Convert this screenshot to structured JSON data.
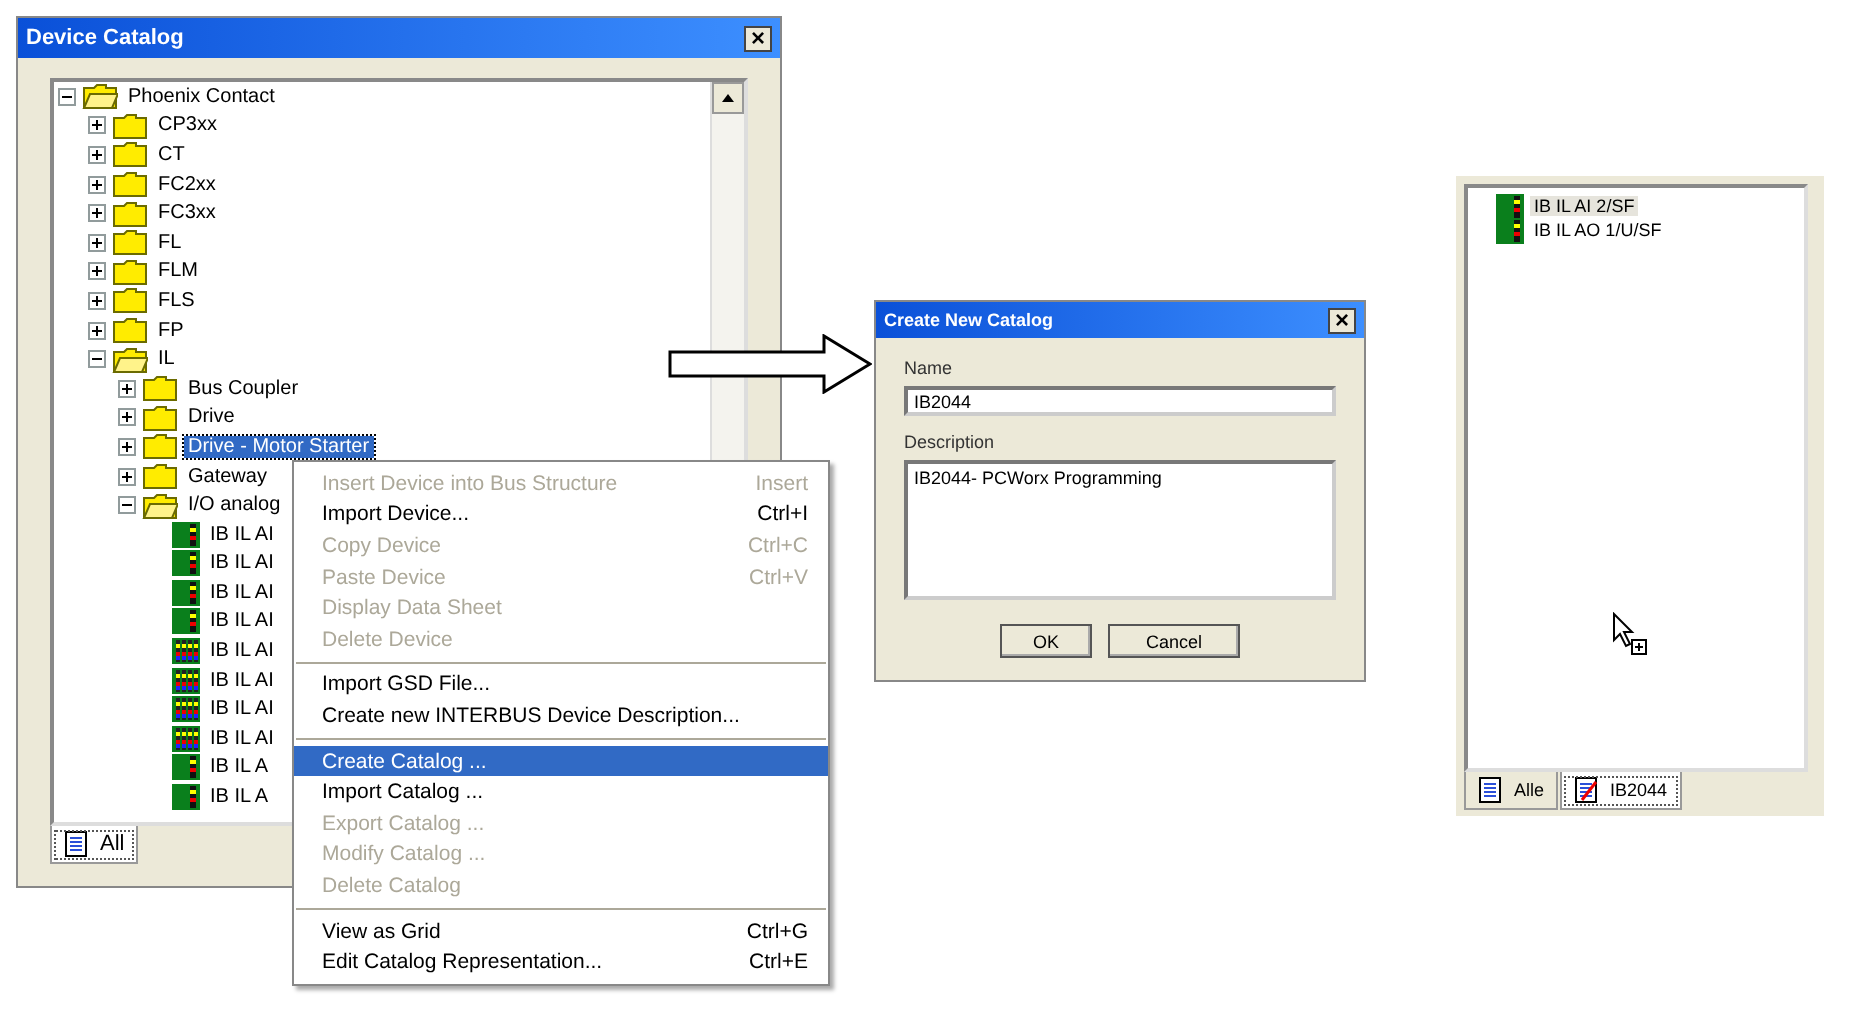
{
  "catalog_window": {
    "title": "Device Catalog",
    "close": "×",
    "tree": [
      {
        "label": "Phoenix Contact",
        "kind": "folder",
        "expanded": true,
        "selected": false,
        "children": [
          {
            "label": "CP3xx",
            "kind": "folder",
            "expanded": false,
            "selected": false
          },
          {
            "label": "CT",
            "kind": "folder",
            "expanded": false,
            "selected": false
          },
          {
            "label": "FC2xx",
            "kind": "folder",
            "expanded": false,
            "selected": false
          },
          {
            "label": "FC3xx",
            "kind": "folder",
            "expanded": false,
            "selected": false
          },
          {
            "label": "FL",
            "kind": "folder",
            "expanded": false,
            "selected": false
          },
          {
            "label": "FLM",
            "kind": "folder",
            "expanded": false,
            "selected": false
          },
          {
            "label": "FLS",
            "kind": "folder",
            "expanded": false,
            "selected": false
          },
          {
            "label": "FP",
            "kind": "folder",
            "expanded": false,
            "selected": false
          },
          {
            "label": "IL",
            "kind": "folder",
            "expanded": true,
            "selected": false,
            "children": [
              {
                "label": "Bus Coupler",
                "kind": "folder",
                "expanded": false,
                "selected": false
              },
              {
                "label": "Drive",
                "kind": "folder",
                "expanded": false,
                "selected": false
              },
              {
                "label": "Drive - Motor Starter",
                "kind": "folder",
                "expanded": false,
                "selected": true
              },
              {
                "label": "Gateway",
                "kind": "folder",
                "expanded": false,
                "selected": false
              },
              {
                "label": "I/O analog",
                "kind": "folder",
                "expanded": true,
                "selected": false,
                "children": [
                  {
                    "label": "IB IL AI",
                    "kind": "module",
                    "selected": false
                  },
                  {
                    "label": "IB IL AI",
                    "kind": "module",
                    "selected": false
                  },
                  {
                    "label": "IB IL AI",
                    "kind": "module",
                    "selected": false
                  },
                  {
                    "label": "IB IL AI",
                    "kind": "module",
                    "selected": false
                  },
                  {
                    "label": "IB IL AI",
                    "kind": "multi-module",
                    "selected": false
                  },
                  {
                    "label": "IB IL AI",
                    "kind": "multi-module",
                    "selected": false
                  },
                  {
                    "label": "IB IL AI",
                    "kind": "multi-module",
                    "selected": false
                  },
                  {
                    "label": "IB IL AI",
                    "kind": "multi-module",
                    "selected": false
                  },
                  {
                    "label": "IB IL A",
                    "kind": "module",
                    "selected": false
                  },
                  {
                    "label": "IB IL A",
                    "kind": "module",
                    "selected": false
                  }
                ]
              }
            ]
          }
        ]
      }
    ],
    "tabs": [
      {
        "label": "All",
        "selected": true
      }
    ]
  },
  "context_menu": [
    {
      "kind": "item",
      "label": "Insert Device into Bus Structure",
      "shortcut": "Insert",
      "disabled": true,
      "selected": false
    },
    {
      "kind": "item",
      "label": "Import Device...",
      "shortcut": "Ctrl+I",
      "disabled": false,
      "selected": false
    },
    {
      "kind": "item",
      "label": "Copy Device",
      "shortcut": "Ctrl+C",
      "disabled": true,
      "selected": false
    },
    {
      "kind": "item",
      "label": "Paste Device",
      "shortcut": "Ctrl+V",
      "disabled": true,
      "selected": false
    },
    {
      "kind": "item",
      "label": "Display Data Sheet",
      "disabled": true,
      "selected": false
    },
    {
      "kind": "item",
      "label": "Delete Device",
      "disabled": true,
      "selected": false
    },
    {
      "kind": "separator"
    },
    {
      "kind": "item",
      "label": "Import GSD File...",
      "disabled": false,
      "selected": false
    },
    {
      "kind": "item",
      "label": "Create new INTERBUS Device Description...",
      "disabled": false,
      "selected": false
    },
    {
      "kind": "separator"
    },
    {
      "kind": "item",
      "label": "Create Catalog ...",
      "disabled": false,
      "selected": true
    },
    {
      "kind": "item",
      "label": "Import Catalog ...",
      "disabled": false,
      "selected": false
    },
    {
      "kind": "item",
      "label": "Export Catalog ...",
      "disabled": true,
      "selected": false
    },
    {
      "kind": "item",
      "label": "Modify Catalog ...",
      "disabled": true,
      "selected": false
    },
    {
      "kind": "item",
      "label": "Delete Catalog",
      "disabled": true,
      "selected": false
    },
    {
      "kind": "separator"
    },
    {
      "kind": "item",
      "label": "View as Grid",
      "shortcut": "Ctrl+G",
      "disabled": false,
      "selected": false
    },
    {
      "kind": "item",
      "label": "Edit Catalog Representation...",
      "shortcut": "Ctrl+E",
      "disabled": false,
      "selected": false
    }
  ],
  "dialog": {
    "title": "Create New Catalog",
    "close": "×",
    "name_label": "Name",
    "name_value": "IB2044",
    "description_label": "Description",
    "description_value": "IB2044- PCWorx Programming",
    "buttons": [
      "OK",
      "Cancel"
    ]
  },
  "result_panel": {
    "tree": [
      {
        "label": "IB IL AI 2/SF",
        "kind": "module",
        "selected": true
      },
      {
        "label": "IB IL AO 1/U/SF",
        "kind": "module",
        "selected": false
      }
    ],
    "tabs": [
      {
        "label": "Alle",
        "selected": false
      },
      {
        "label": "IB2044",
        "selected": true
      }
    ]
  }
}
